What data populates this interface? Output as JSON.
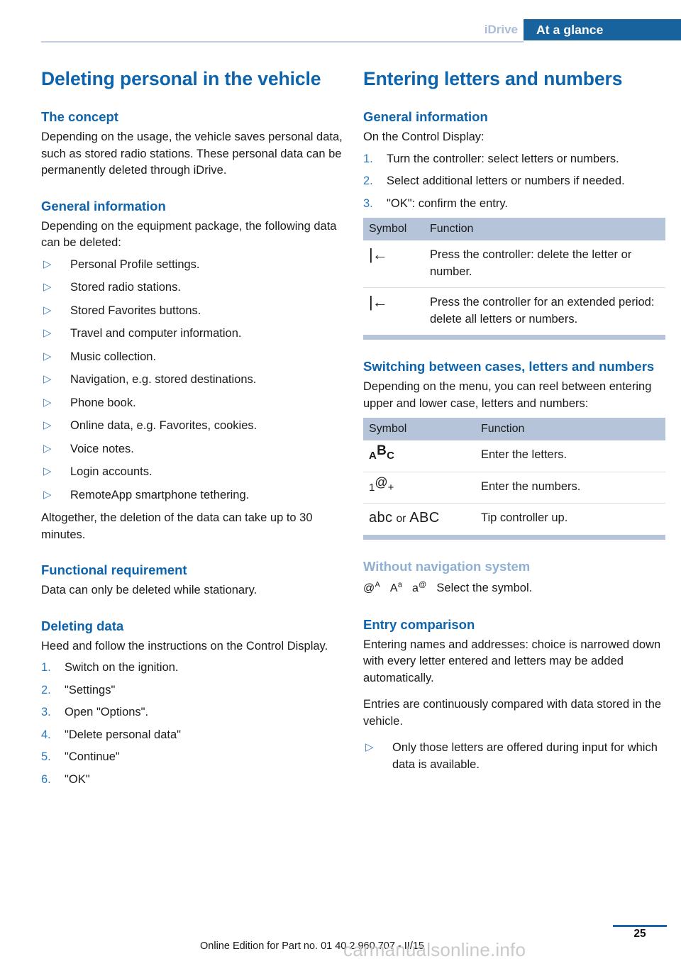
{
  "header": {
    "chapter": "iDrive",
    "section": "At a glance"
  },
  "left_column": {
    "title": "Deleting personal in the vehicle",
    "sections": [
      {
        "heading": "The concept",
        "paragraphs": [
          "Depending on the usage, the vehicle saves personal data, such as stored radio stations. These personal data can be permanently deleted through iDrive."
        ]
      },
      {
        "heading": "General information",
        "intro": "Depending on the equipment package, the following data can be deleted:",
        "bullets": [
          "Personal Profile settings.",
          "Stored radio stations.",
          "Stored Favorites buttons.",
          "Travel and computer information.",
          "Music collection.",
          "Navigation, e.g. stored destinations.",
          "Phone book.",
          "Online data, e.g. Favorites, cookies.",
          "Voice notes.",
          "Login accounts.",
          "RemoteApp smartphone tethering."
        ],
        "outro": "Altogether, the deletion of the data can take up to 30 minutes."
      },
      {
        "heading": "Functional requirement",
        "paragraphs": [
          "Data can only be deleted while stationary."
        ]
      },
      {
        "heading": "Deleting data",
        "intro": "Heed and follow the instructions on the Control Display.",
        "steps": [
          "Switch on the ignition.",
          "\"Settings\"",
          "Open \"Options\".",
          "\"Delete personal data\"",
          "\"Continue\"",
          "\"OK\""
        ]
      }
    ]
  },
  "right_column": {
    "title": "Entering letters and numbers",
    "general_information": {
      "heading": "General information",
      "intro": "On the Control Display:",
      "steps": [
        "Turn the controller: select letters or numbers.",
        "Select additional letters or numbers if needed.",
        "\"OK\": confirm the entry."
      ]
    },
    "delete_table": {
      "headers": [
        "Symbol",
        "Function"
      ],
      "rows": [
        {
          "symbol": "backspace-icon",
          "function": "Press the controller: delete the letter or number."
        },
        {
          "symbol": "backspace-icon",
          "function": "Press the controller for an extended period: delete all letters or numbers."
        }
      ]
    },
    "switching": {
      "heading": "Switching between cases, letters and numbers",
      "intro": "Depending on the menu, you can reel between entering upper and lower case, letters and numbers:"
    },
    "switch_table": {
      "headers": [
        "Symbol",
        "Function"
      ],
      "rows": [
        {
          "symbol_parts": [
            "A",
            "B",
            "C"
          ],
          "symbol_text": "A B C",
          "function": "Enter the letters."
        },
        {
          "symbol_parts": [
            "1",
            "@",
            "+"
          ],
          "symbol_text": "1 @ +",
          "function": "Enter the numbers."
        },
        {
          "symbol_parts": [
            "abc",
            "or",
            "ABC"
          ],
          "symbol_text": "abc or ABC",
          "function": "Tip controller up."
        }
      ]
    },
    "without_navigation": {
      "heading": "Without navigation system",
      "symbols": [
        {
          "base": "@",
          "sup": "A"
        },
        {
          "base": "A",
          "sup": "a"
        },
        {
          "base": "a",
          "sup": "@"
        }
      ],
      "text": "Select the symbol."
    },
    "entry_comparison": {
      "heading": "Entry comparison",
      "paragraphs": [
        "Entering names and addresses: choice is narrowed down with every letter entered and letters may be added automatically.",
        "Entries are continuously compared with data stored in the vehicle."
      ],
      "bullets": [
        "Only those letters are offered during input for which data is available."
      ]
    }
  },
  "footer": {
    "edition_text": "Online Edition for Part no. 01 40 2 960 707 - II/15",
    "page_number": "25",
    "watermark": "carmanualsonline.info"
  },
  "colors": {
    "brand_blue": "#0d63ac",
    "band_blue": "#18639e",
    "pale_blue": "#8fb0d3",
    "table_header": "#b6c4da",
    "rule": "#c3cfe0"
  }
}
